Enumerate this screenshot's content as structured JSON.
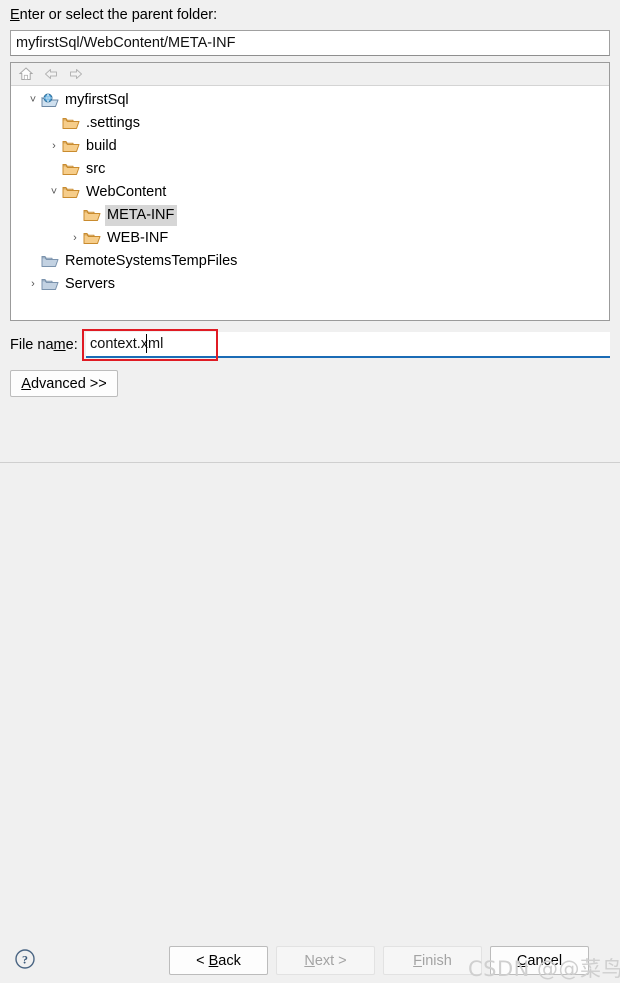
{
  "dialog": {
    "parent_folder_label": "Enter or select the parent folder:",
    "parent_folder_label_mnemonic": "E",
    "parent_folder_label_rest": "nter or select the parent folder:",
    "parent_folder_value": "myfirstSql/WebContent/META-INF"
  },
  "toolbar": {
    "home_icon": "home-icon",
    "back_icon": "arrow-left-icon",
    "forward_icon": "arrow-right-icon"
  },
  "tree": {
    "nodes": [
      {
        "label": "myfirstSql",
        "indent": 0,
        "twisty": "˅",
        "icon": "project-folder-icon",
        "selected": false
      },
      {
        "label": ".settings",
        "indent": 1,
        "twisty": "",
        "icon": "folder-icon",
        "selected": false
      },
      {
        "label": "build",
        "indent": 1,
        "twisty": "›",
        "icon": "folder-icon",
        "selected": false
      },
      {
        "label": "src",
        "indent": 1,
        "twisty": "",
        "icon": "folder-icon",
        "selected": false
      },
      {
        "label": "WebContent",
        "indent": 1,
        "twisty": "˅",
        "icon": "folder-icon",
        "selected": false
      },
      {
        "label": "META-INF",
        "indent": 2,
        "twisty": "",
        "icon": "folder-icon",
        "selected": true
      },
      {
        "label": "WEB-INF",
        "indent": 2,
        "twisty": "›",
        "icon": "folder-icon",
        "selected": false
      },
      {
        "label": "RemoteSystemsTempFiles",
        "indent": 0,
        "twisty": "",
        "icon": "blue-folder-icon",
        "selected": false
      },
      {
        "label": "Servers",
        "indent": 0,
        "twisty": "›",
        "icon": "blue-folder-icon",
        "selected": false
      }
    ]
  },
  "filename": {
    "label_pre": "File na",
    "label_mnemonic": "m",
    "label_post": "e:",
    "value": "context.xml"
  },
  "advanced": {
    "label_mnemonic": "A",
    "label_rest": "dvanced >>"
  },
  "footer": {
    "help_icon": "help-circle-icon",
    "back": {
      "pre": "< ",
      "mnemonic": "B",
      "post": "ack",
      "disabled": false
    },
    "next": {
      "pre": "",
      "mnemonic": "N",
      "post": "ext >",
      "disabled": true
    },
    "finish": {
      "pre": "",
      "mnemonic": "F",
      "post": "inish",
      "disabled": true
    },
    "cancel": {
      "pre": "",
      "mnemonic": "C",
      "post": "ancel",
      "disabled": false
    }
  },
  "watermark": {
    "text": "CSDN @@菜鸟先飞"
  },
  "colors": {
    "accent_blue": "#1a6bb5",
    "annotation_red": "#e01b24",
    "selection_gray": "#d6d6d6",
    "folder_orange": "#e8a33d",
    "folder_blue": "#7a96b8",
    "background": "#f0f0f0"
  }
}
